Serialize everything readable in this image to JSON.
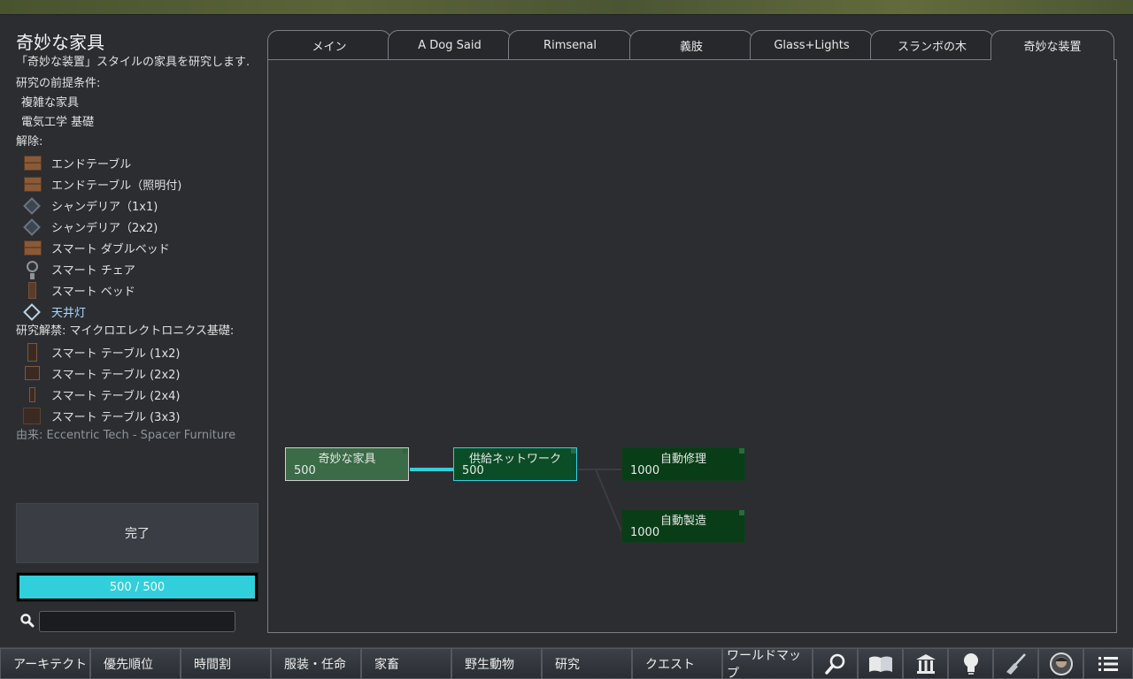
{
  "left": {
    "title": "奇妙な家具",
    "description": "「奇妙な装置」スタイルの家具を研究します.",
    "prereq_header": "研究の前提条件:",
    "prerequisites": [
      "複雑な家具",
      "電気工学 基礎"
    ],
    "unlocks_header": "解除:",
    "unlocks": [
      {
        "label": "エンドテーブル",
        "icon": "end-table-icon"
      },
      {
        "label": "エンドテーブル（照明付)",
        "icon": "end-table-lit-icon"
      },
      {
        "label": "シャンデリア（1x1)",
        "icon": "chandelier-icon"
      },
      {
        "label": "シャンデリア（2x2)",
        "icon": "chandelier-large-icon"
      },
      {
        "label": "スマート ダブルベッド",
        "icon": "double-bed-icon"
      },
      {
        "label": "スマート チェア",
        "icon": "chair-icon"
      },
      {
        "label": "スマート ベッド",
        "icon": "bed-icon"
      },
      {
        "label": "天井灯",
        "icon": "ceiling-light-icon"
      }
    ],
    "forbidden_header": "研究解禁: マイクロエレクトロニクス基礎:",
    "forbidden": [
      {
        "label": "スマート テーブル (1x2)",
        "icon": "table-1x2-icon"
      },
      {
        "label": "スマート テーブル (2x2)",
        "icon": "table-2x2-icon"
      },
      {
        "label": "スマート テーブル (2x4)",
        "icon": "table-2x4-icon"
      },
      {
        "label": "スマート テーブル (3x3)",
        "icon": "table-3x3-icon"
      }
    ],
    "source": "由来:  Eccentric Tech - Spacer Furniture",
    "done_label": "完了",
    "progress_text": "500 / 500",
    "progress_fraction": 1.0,
    "search_value": ""
  },
  "tabs": [
    "メイン",
    "A Dog Said",
    "Rimsenal",
    "義肢",
    "Glass+Lights",
    "スランボの木",
    "奇妙な装置"
  ],
  "active_tab": "奇妙な装置",
  "nodes": [
    {
      "name": "奇妙な家具",
      "cost": "500",
      "state": "done"
    },
    {
      "name": "供給ネットワーク",
      "cost": "500",
      "state": "avail"
    },
    {
      "name": "自動修理",
      "cost": "1000",
      "state": "locked"
    },
    {
      "name": "自動製造",
      "cost": "1000",
      "state": "locked"
    }
  ],
  "bottom_bar": [
    "アーキテクト",
    "優先順位",
    "時間割",
    "服装・任命",
    "家畜",
    "野生動物",
    "研究",
    "クエスト",
    "ワールドマップ"
  ],
  "bottom_icons": [
    "search-icon",
    "book-icon",
    "factions-icon",
    "ideas-lightbulb-icon",
    "broom-icon",
    "pawn-portrait-icon",
    "menu-list-icon"
  ],
  "colors": {
    "progress": "#31cfdb",
    "done_node": "#3b6b47",
    "available_node": "#0b4d26",
    "locked_node": "#083d17"
  }
}
